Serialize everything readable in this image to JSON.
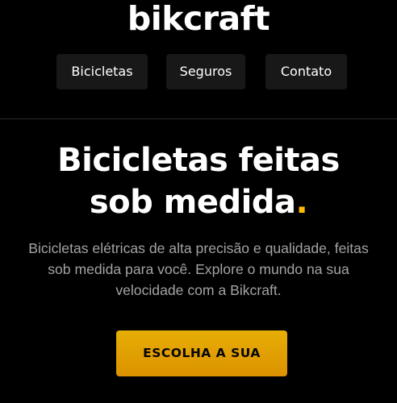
{
  "header": {
    "logo": "bikcraft",
    "nav": [
      {
        "label": "Bicicletas"
      },
      {
        "label": "Seguros"
      },
      {
        "label": "Contato"
      }
    ]
  },
  "hero": {
    "title_line1": "Bicicletas feitas",
    "title_line2": "sob medida",
    "title_dot": ".",
    "description": "Bicicletas elétricas de alta precisão e qualidade, feitas sob medida para você. Explore o mundo na sua velocidade com a Bikcraft.",
    "cta_label": "ESCOLHA A SUA"
  },
  "colors": {
    "background": "#000000",
    "accent": "#ffbb00",
    "nav_bg": "#181818",
    "text": "#ffffff",
    "muted_text": "#a3a3a3"
  }
}
